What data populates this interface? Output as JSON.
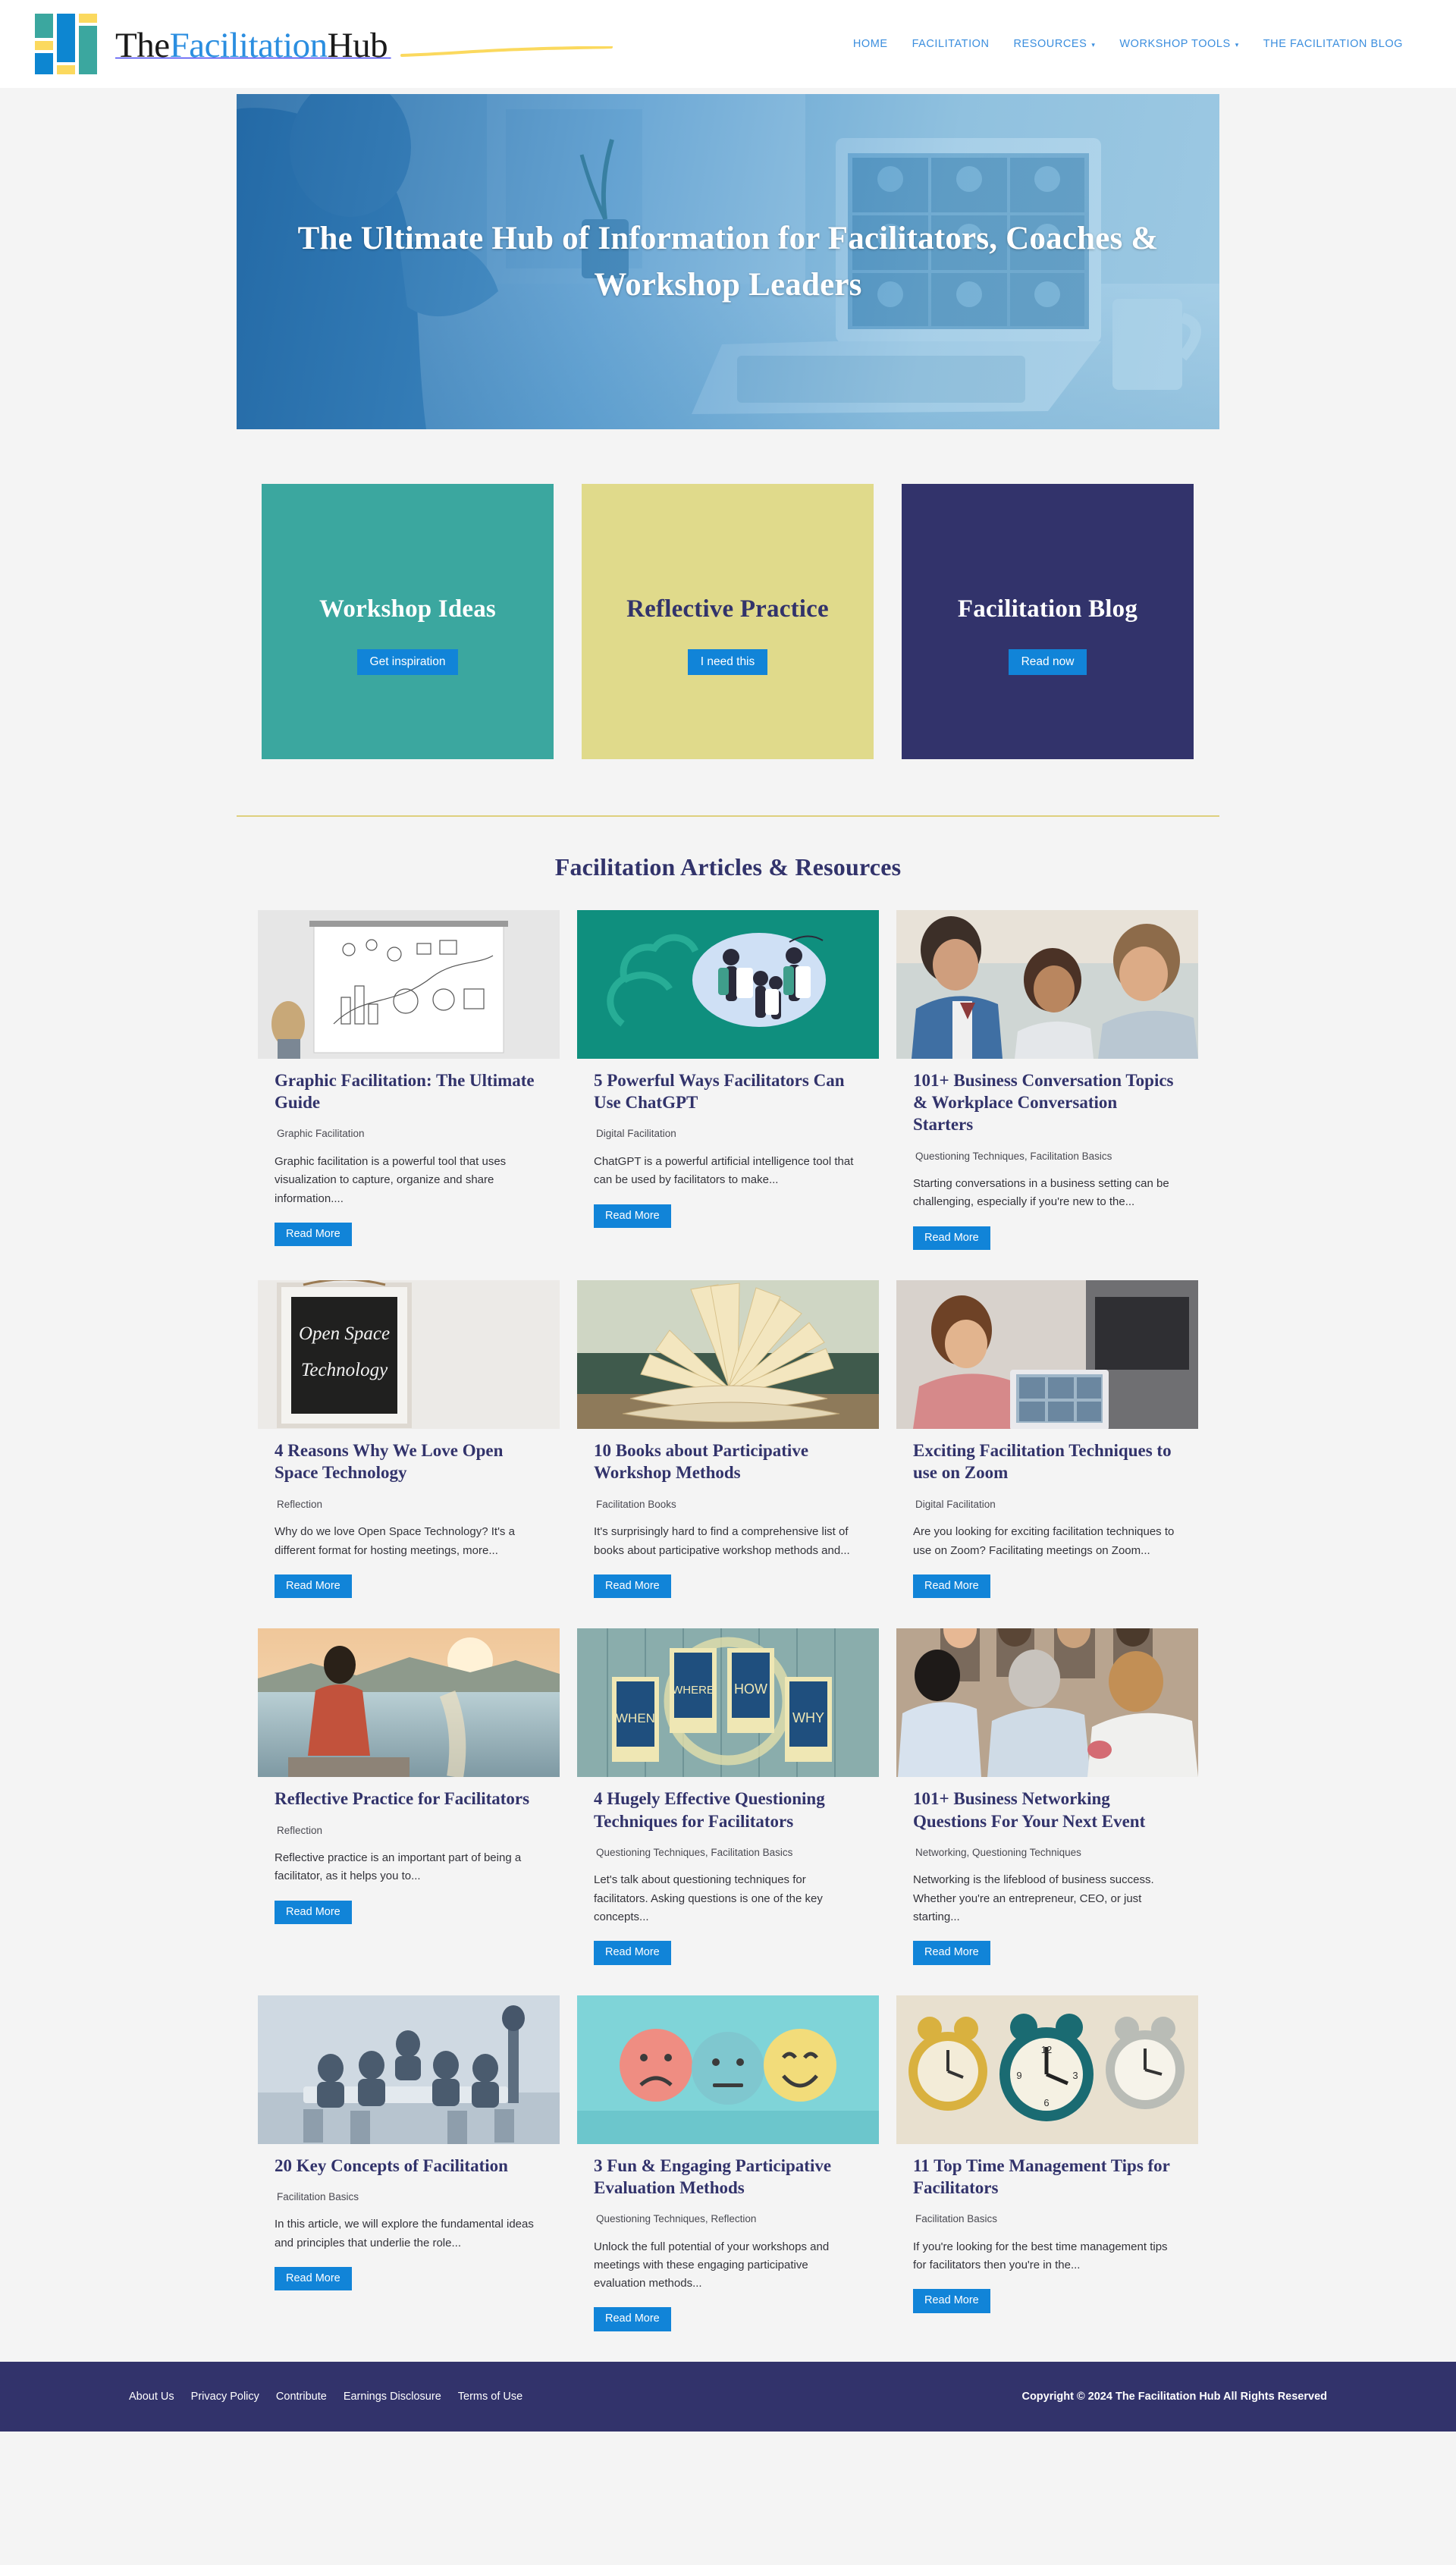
{
  "header": {
    "brand": {
      "part1": "The",
      "part2": "Facilitation",
      "part3": "Hub",
      "logo_icon": "bar-blocks-logo-icon"
    },
    "nav": [
      {
        "label": "HOME",
        "has_caret": false
      },
      {
        "label": "FACILITATION",
        "has_caret": false
      },
      {
        "label": "RESOURCES",
        "has_caret": true
      },
      {
        "label": "WORKSHOP TOOLS",
        "has_caret": true
      },
      {
        "label": "THE FACILITATION BLOG",
        "has_caret": false
      }
    ]
  },
  "hero": {
    "title": "The Ultimate Hub of Information for Facilitators, Coaches & Workshop Leaders"
  },
  "promos": [
    {
      "title": "Workshop Ideas",
      "button": "Get inspiration",
      "bg": "#3ba79f",
      "title_color": "#ffffff"
    },
    {
      "title": "Reflective Practice",
      "button": "I need this",
      "bg": "#e0da8b",
      "title_color": "#32336b"
    },
    {
      "title": "Facilitation Blog",
      "button": "Read now",
      "bg": "#32336b",
      "title_color": "#ffffff"
    }
  ],
  "section": {
    "title": "Facilitation Articles & Resources",
    "divider_color": "#ded07e"
  },
  "read_more_label": "Read More",
  "articles": [
    {
      "title": "Graphic Facilitation: The Ultimate Guide",
      "categories": "Graphic Facilitation",
      "excerpt": "Graphic facilitation is a powerful tool that uses visualization to capture, organize and share information....",
      "thumb": "whiteboard-sketchnote-photo"
    },
    {
      "title": "5 Powerful Ways Facilitators Can Use ChatGPT",
      "categories": "Digital Facilitation",
      "excerpt": "ChatGPT is a powerful artificial intelligence tool that can be used by facilitators to make...",
      "thumb": "chatgpt-green-illustration"
    },
    {
      "title": "101+ Business Conversation Topics & Workplace Conversation Starters",
      "categories": "Questioning Techniques, Facilitation Basics",
      "excerpt": "Starting conversations in a business setting can be challenging, especially if you're new to the...",
      "thumb": "colleagues-talking-photo"
    },
    {
      "title": "4 Reasons Why We Love Open Space Technology",
      "categories": "Reflection",
      "excerpt": "Why do we love Open Space Technology? It's a different format for hosting meetings, more...",
      "thumb": "open-space-chalkboard-photo"
    },
    {
      "title": "10 Books about Participative Workshop Methods",
      "categories": "Facilitation Books",
      "excerpt": "It's surprisingly hard to find a comprehensive list of books about participative workshop methods and...",
      "thumb": "open-book-photo"
    },
    {
      "title": "Exciting Facilitation Techniques to use on Zoom",
      "categories": "Digital Facilitation",
      "excerpt": "Are you looking for exciting facilitation techniques to use on Zoom? Facilitating meetings on Zoom...",
      "thumb": "woman-video-call-photo"
    },
    {
      "title": "Reflective Practice for Facilitators",
      "categories": "Reflection",
      "excerpt": "Reflective practice is an important part of being a facilitator, as it helps you to...",
      "thumb": "woman-sunset-sea-photo"
    },
    {
      "title": "4 Hugely Effective Questioning Techniques for Facilitators",
      "categories": "Questioning Techniques, Facilitation Basics",
      "excerpt": "Let's talk about questioning techniques for facilitators. Asking questions is one of the key concepts...",
      "thumb": "when-where-how-why-signs-photo"
    },
    {
      "title": "101+ Business Networking Questions For Your Next Event",
      "categories": "Networking, Questioning Techniques",
      "excerpt": "Networking is the lifeblood of business success. Whether you're an entrepreneur, CEO, or just starting...",
      "thumb": "networking-event-photo"
    },
    {
      "title": "20 Key Concepts of Facilitation",
      "categories": "Facilitation Basics",
      "excerpt": "In this article, we will explore the fundamental ideas and principles that underlie the role...",
      "thumb": "meeting-table-photo"
    },
    {
      "title": "3 Fun & Engaging Participative Evaluation Methods",
      "categories": "Questioning Techniques, Reflection",
      "excerpt": "Unlock the full potential of your workshops and meetings with these engaging participative evaluation methods...",
      "thumb": "emoji-faces-photo"
    },
    {
      "title": "11 Top Time Management Tips for Facilitators",
      "categories": "Facilitation Basics",
      "excerpt": "If you're looking for the best time management tips for facilitators then you're in the...",
      "thumb": "alarm-clocks-photo"
    }
  ],
  "footer": {
    "links": [
      "About Us",
      "Privacy Policy",
      "Contribute",
      "Earnings Disclosure",
      "Terms of Use"
    ],
    "copyright": "Copyright © 2024 The Facilitation Hub All Rights Reserved"
  }
}
